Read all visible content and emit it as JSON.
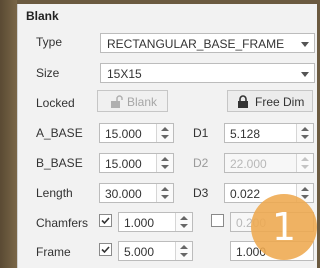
{
  "section_title": "Blank",
  "type": {
    "label": "Type",
    "value": "RECTANGULAR_BASE_FRAME"
  },
  "size": {
    "label": "Size",
    "value": "15X15"
  },
  "locked": {
    "label": "Locked",
    "blank_button": "Blank",
    "free_dim_button": "Free Dim"
  },
  "a_base": {
    "label": "A_BASE",
    "value": "15.000"
  },
  "b_base": {
    "label": "B_BASE",
    "value": "15.000"
  },
  "length": {
    "label": "Length",
    "value": "30.000"
  },
  "d1": {
    "label": "D1",
    "value": "5.128"
  },
  "d2": {
    "label": "D2",
    "value": "22.000"
  },
  "d3": {
    "label": "D3",
    "value": "0.022"
  },
  "chamfers": {
    "label": "Chamfers",
    "checked": true,
    "value": "1.000",
    "secondary_checked": false,
    "secondary_value": "0.200"
  },
  "frame": {
    "label": "Frame",
    "checked": true,
    "value": "5.000",
    "secondary_value": "1.000"
  },
  "step_badge": "1",
  "colors": {
    "badge": "#eea84e",
    "panel": "#f2f2f2"
  },
  "icons": {
    "locked_blank": "unlock-icon",
    "free_dim": "lock-icon",
    "checkbox": "check-icon"
  }
}
